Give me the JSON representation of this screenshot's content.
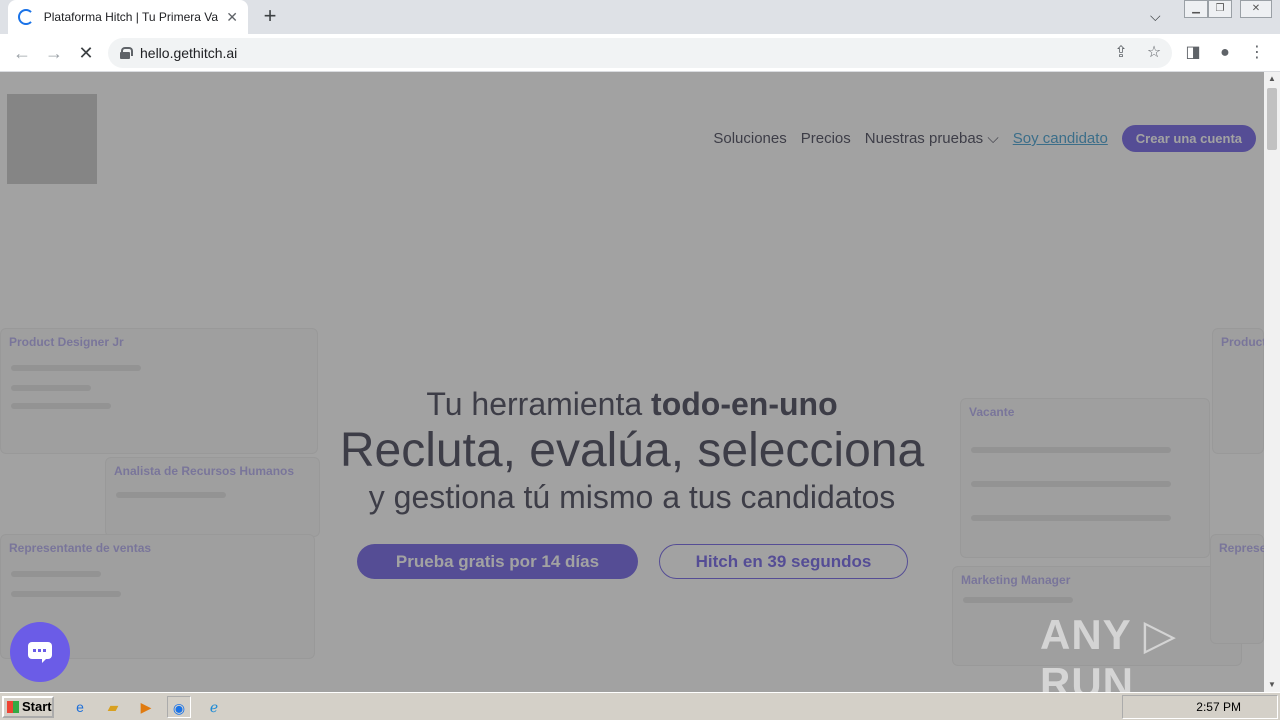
{
  "browser": {
    "tab_title": "Plataforma Hitch | Tu Primera Vacante",
    "new_tab": "+",
    "url": "hello.gethitch.ai"
  },
  "nav": {
    "items": [
      "Soluciones",
      "Precios",
      "Nuestras pruebas ⌵",
      "Soy candidato"
    ],
    "cta": "Crear una cuenta"
  },
  "hero": {
    "line1_prefix": "Tu herramienta ",
    "line1_bold": "todo-en-uno",
    "line2": "Recluta, evalúa, selecciona",
    "line3": "y gestiona tú mismo a tus candidatos",
    "primary_button": "Prueba gratis por 14 días",
    "secondary_button": "Hitch en 39 segundos"
  },
  "bg_cards": {
    "c1": "Product Designer Jr",
    "c2": "Analista de Recursos Humanos",
    "c3": "Representante de ventas",
    "c4": "Vacante",
    "c5": "Marketing Manager",
    "c6": "Product",
    "c7": "Represe"
  },
  "watermark": "ANY ▷ RUN",
  "taskbar": {
    "start": "Start",
    "time": "2:57 PM"
  }
}
